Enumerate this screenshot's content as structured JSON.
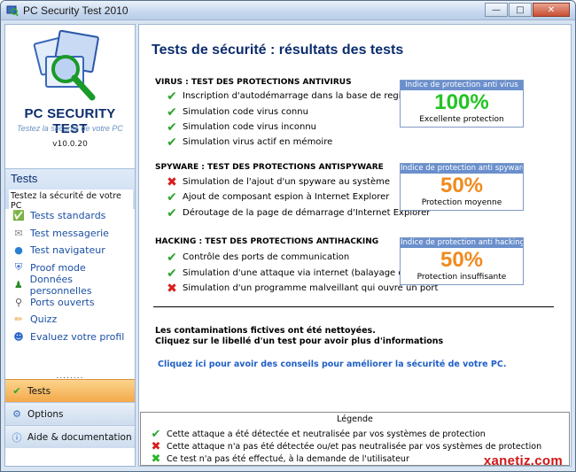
{
  "window": {
    "title": "PC Security Test 2010"
  },
  "sidebar": {
    "logo_title": "PC SECURITY TEST",
    "logo_subtitle": "Testez la sécurité de votre PC",
    "version": "v10.0.20",
    "section_title": "Tests",
    "section_desc": "Testez la sécurité de votre PC",
    "items": [
      {
        "label": "Tests standards",
        "icon": "check-list-icon"
      },
      {
        "label": "Test messagerie",
        "icon": "envelope-icon"
      },
      {
        "label": "Test navigateur",
        "icon": "globe-icon"
      },
      {
        "label": "Proof mode",
        "icon": "shield-icon"
      },
      {
        "label": "Données personnelles",
        "icon": "users-icon"
      },
      {
        "label": "Ports ouverts",
        "icon": "magnifier-icon"
      },
      {
        "label": "Quizz",
        "icon": "pencil-icon"
      },
      {
        "label": "Evaluez votre profil",
        "icon": "profile-icon"
      }
    ],
    "dots": "........",
    "bottom_tabs": [
      {
        "label": "Tests",
        "icon": "check-icon",
        "active": true
      },
      {
        "label": "Options",
        "icon": "gear-icon",
        "active": false
      },
      {
        "label": "Aide & documentation",
        "icon": "info-icon",
        "active": false
      }
    ]
  },
  "main": {
    "title": "Tests de sécurité : résultats des tests",
    "groups": [
      {
        "title": "VIRUS : TEST DES PROTECTIONS ANTIVIRUS",
        "tests": [
          {
            "label": "Inscription d'autodémarrage dans la base de registres",
            "status": "ok"
          },
          {
            "label": "Simulation code virus connu",
            "status": "ok"
          },
          {
            "label": "Simulation code virus inconnu",
            "status": "ok"
          },
          {
            "label": "Simulation virus actif en mémoire",
            "status": "ok"
          }
        ],
        "index": {
          "header": "Indice de protection anti virus",
          "value": "100%",
          "label": "Excellente protection",
          "color": "#22c422"
        }
      },
      {
        "title": "SPYWARE : TEST DES PROTECTIONS ANTISPYWARE",
        "tests": [
          {
            "label": "Simulation de l'ajout d'un spyware au système",
            "status": "ko"
          },
          {
            "label": "Ajout de composant espion à Internet Explorer",
            "status": "ok"
          },
          {
            "label": "Déroutage de la page de démarrage d'Internet Explorer",
            "status": "ok"
          }
        ],
        "index": {
          "header": "Indice de protection anti spyware",
          "value": "50%",
          "label": "Protection moyenne",
          "color": "#f08a1c"
        }
      },
      {
        "title": "HACKING : TEST DES PROTECTIONS ANTIHACKING",
        "tests": [
          {
            "label": "Contrôle des ports de communication",
            "status": "ok"
          },
          {
            "label": "Simulation d'une attaque via internet (balayage de port)",
            "status": "ok"
          },
          {
            "label": "Simulation d'un programme malveillant qui ouvre un port",
            "status": "ko"
          }
        ],
        "index": {
          "header": "Indice de protection anti hacking",
          "value": "50%",
          "label": "Protection insuffisante",
          "color": "#f08a1c"
        }
      }
    ],
    "info_line1": "Les contaminations fictives ont été nettoyées.",
    "info_line2": "Cliquez sur le libellé d'un test pour avoir plus d'informations",
    "advice_link": "Cliquez ici pour avoir des conseils pour améliorer la sécurité de votre PC.",
    "legend": {
      "title": "Légende",
      "rows": [
        {
          "label": "Cette attaque a été détectée et neutralisée par vos systèmes de protection",
          "status": "ok"
        },
        {
          "label": "Cette attaque n'a pas été détectée ou/et pas neutralisée par vos systèmes de protection",
          "status": "ko"
        },
        {
          "label": "Ce test n'a pas été effectué, à la demande de l'utilisateur",
          "status": "na"
        }
      ]
    }
  },
  "watermark": "xanetiz.com"
}
